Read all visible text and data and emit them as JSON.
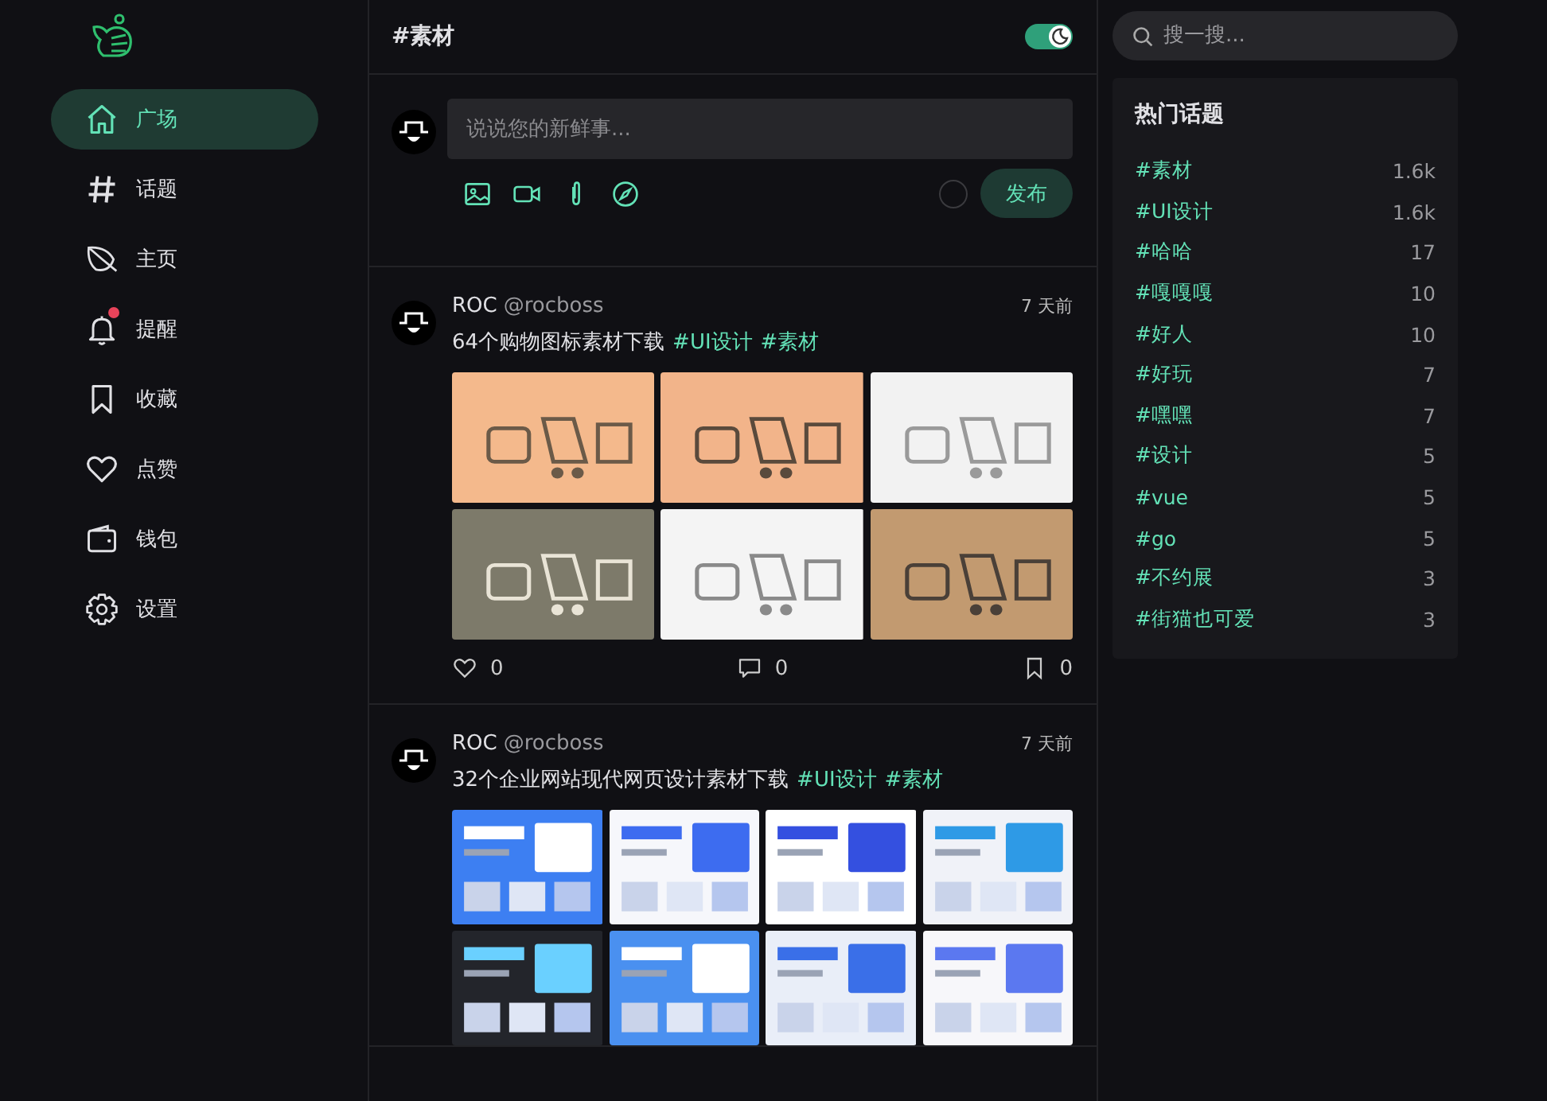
{
  "nav": [
    {
      "label": "广场",
      "kind": "home",
      "selected": true,
      "unread": false
    },
    {
      "label": "话题",
      "kind": "hash",
      "selected": false,
      "unread": false
    },
    {
      "label": "主页",
      "kind": "leaf",
      "selected": false,
      "unread": false
    },
    {
      "label": "提醒",
      "kind": "bell",
      "selected": false,
      "unread": true
    },
    {
      "label": "收藏",
      "kind": "bookmark",
      "selected": false,
      "unread": false
    },
    {
      "label": "点赞",
      "kind": "heart",
      "selected": false,
      "unread": false
    },
    {
      "label": "钱包",
      "kind": "wallet",
      "selected": false,
      "unread": false
    },
    {
      "label": "设置",
      "kind": "gear",
      "selected": false,
      "unread": false
    }
  ],
  "header": {
    "title": "#素材",
    "dark_mode": true
  },
  "composer": {
    "placeholder": "说说您的新鲜事...",
    "submit": "发布"
  },
  "posts": [
    {
      "name": "ROC",
      "handle": "@rocboss",
      "time": "7 天前",
      "text": "64个购物图标素材下载",
      "tags": [
        "#UI设计",
        "#素材"
      ],
      "images": [
        {
          "kind": "picture"
        },
        {
          "kind": "picture"
        },
        {
          "kind": "picture"
        },
        {
          "kind": "picture"
        },
        {
          "kind": "picture"
        },
        {
          "kind": "picture"
        }
      ],
      "actions": [
        {
          "kind": "like",
          "count": "0"
        },
        {
          "kind": "comment",
          "count": "0"
        },
        {
          "kind": "bookmark",
          "count": "0"
        }
      ]
    },
    {
      "name": "ROC",
      "handle": "@rocboss",
      "time": "7 天前",
      "text": "32个企业网站现代网页设计素材下载",
      "tags": [
        "#UI设计",
        "#素材"
      ],
      "images": [
        {
          "kind": "picture"
        },
        {
          "kind": "picture"
        },
        {
          "kind": "picture"
        },
        {
          "kind": "picture"
        },
        {
          "kind": "picture"
        },
        {
          "kind": "picture"
        },
        {
          "kind": "picture"
        },
        {
          "kind": "picture"
        }
      ]
    }
  ],
  "search": {
    "placeholder": "搜一搜..."
  },
  "hot_topics": {
    "title": "热门话题",
    "items": [
      {
        "tag": "#素材",
        "count": "1.6k"
      },
      {
        "tag": "#UI设计",
        "count": "1.6k"
      },
      {
        "tag": "#哈哈",
        "count": "17"
      },
      {
        "tag": "#嘎嘎嘎",
        "count": "10"
      },
      {
        "tag": "#好人",
        "count": "10"
      },
      {
        "tag": "#好玩",
        "count": "7"
      },
      {
        "tag": "#嘿嘿",
        "count": "7"
      },
      {
        "tag": "#设计",
        "count": "5"
      },
      {
        "tag": "#vue",
        "count": "5"
      },
      {
        "tag": "#go",
        "count": "5"
      },
      {
        "tag": "#不约展",
        "count": "3"
      },
      {
        "tag": "#街猫也可爱",
        "count": "3"
      }
    ]
  }
}
